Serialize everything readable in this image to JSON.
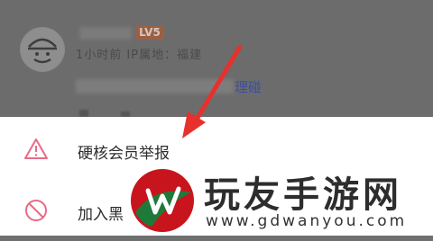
{
  "background": {
    "level_badge": "LV5",
    "meta_text": "1小时前 IP属地：福建",
    "comment_tail": "理碰"
  },
  "menu": {
    "items": [
      {
        "label": "硬核会员举报",
        "icon": "warning-icon"
      },
      {
        "label": "加入黑",
        "icon": "block-icon"
      }
    ]
  },
  "watermark": {
    "title": "玩友手游网",
    "url": "www.gdwanyou.com",
    "logo_letter": "W"
  },
  "colors": {
    "overlay": "#6f6f6f",
    "sheet": "#ffffff",
    "icon_pink": "#e86a86",
    "arrow_red": "#e8302c",
    "badge": "#9a6045",
    "logo_red": "#c8151d",
    "logo_green": "#1f7a3a"
  }
}
